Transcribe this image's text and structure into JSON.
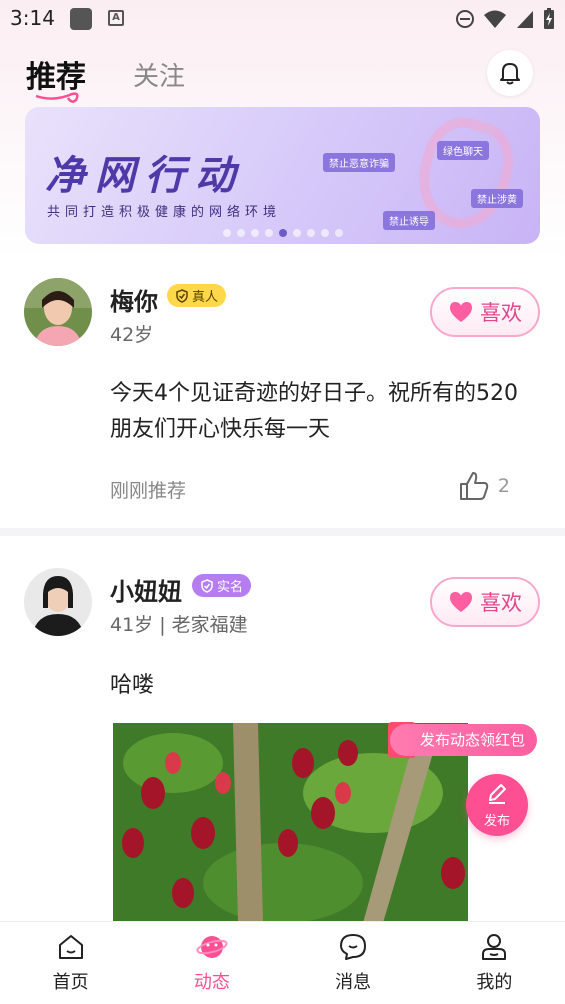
{
  "status_bar": {
    "time": "3:14"
  },
  "header": {
    "tabs": [
      {
        "label": "推荐",
        "active": true
      },
      {
        "label": "关注",
        "active": false
      }
    ]
  },
  "banner": {
    "title": "净网行动",
    "subtitle": "共同打造积极健康的网络环境",
    "tags": [
      "禁止恶意诈骗",
      "绿色聊天",
      "禁止涉黄",
      "禁止诱导"
    ],
    "page_count": 9,
    "active_page": 5
  },
  "posts": [
    {
      "name": "梅你",
      "badge": "真人",
      "meta": "42岁",
      "content": "今天4个见证奇迹的好日子。祝所有的520朋友们开心快乐每一天",
      "time": "刚刚推荐",
      "likes": "2",
      "like_label": "喜欢"
    },
    {
      "name": "小妞妞",
      "badge": "实名",
      "meta": "41岁 | 老家福建",
      "content": "哈喽",
      "like_label": "喜欢"
    }
  ],
  "promo": {
    "label": "发布动态领红包"
  },
  "publish": {
    "label": "发布"
  },
  "nav": [
    {
      "label": "首页",
      "icon": "home-icon",
      "active": false
    },
    {
      "label": "动态",
      "icon": "planet-icon",
      "active": true
    },
    {
      "label": "消息",
      "icon": "chat-icon",
      "active": false
    },
    {
      "label": "我的",
      "icon": "profile-icon",
      "active": false
    }
  ],
  "colors": {
    "accent": "#ff4f93",
    "like": "#e3458d",
    "banner": "#4d3aa8"
  }
}
